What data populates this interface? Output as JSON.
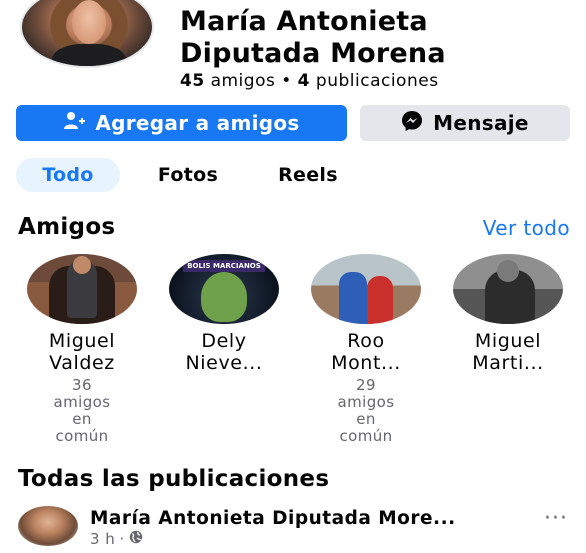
{
  "profile": {
    "name_line1": "María Antonieta",
    "name_line2": "Diputada Morena",
    "friends_count": "45",
    "friends_label": "amigos",
    "posts_count": "4",
    "posts_label": "publicaciones",
    "separator": "•"
  },
  "actions": {
    "add_friend_label": "Agregar a amigos",
    "message_label": "Mensaje",
    "add_friend_icon": "add-friend-icon",
    "message_icon": "messenger-icon"
  },
  "tabs": [
    {
      "label": "Todo",
      "active": true
    },
    {
      "label": "Fotos",
      "active": false
    },
    {
      "label": "Reels",
      "active": false
    }
  ],
  "friends_section": {
    "title": "Amigos",
    "see_all": "Ver todo",
    "friends": [
      {
        "name_line1": "Miguel",
        "name_line2": "Valdez",
        "mutual": [
          "36",
          "amigos",
          "en",
          "común"
        ]
      },
      {
        "name_line1": "Dely",
        "name_line2": "Nieve...",
        "mutual": [],
        "avatar_text": "BOLIS MARCIANOS"
      },
      {
        "name_line1": "Roo",
        "name_line2": "Mont...",
        "mutual": [
          "29",
          "amigos",
          "en",
          "común"
        ]
      },
      {
        "name_line1": "Miguel",
        "name_line2": "Marti...",
        "mutual": []
      }
    ]
  },
  "posts_section": {
    "title": "Todas las publicaciones",
    "post": {
      "author": "María Antonieta Diputada More...",
      "time": "3 h",
      "dot": "·",
      "privacy_icon": "globe-icon",
      "more": "···"
    }
  },
  "colors": {
    "accent": "#1877f2",
    "button_secondary": "#e4e6eb",
    "tab_active_bg": "#e7f3ff",
    "secondary_text": "#65676b"
  }
}
